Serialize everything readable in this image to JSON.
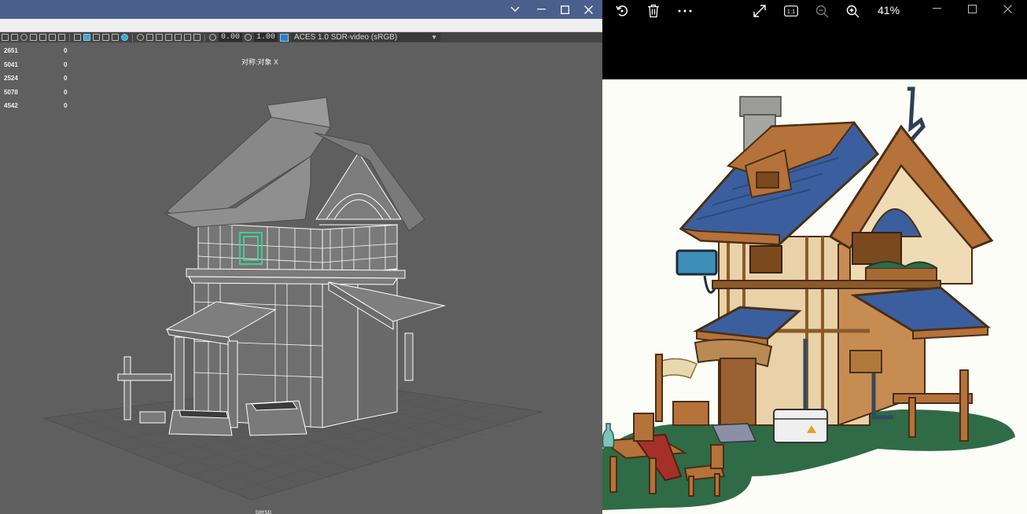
{
  "maya": {
    "title_bar": {
      "minimize_icon": "chevron-down",
      "restore_icon": "minimize",
      "maximize_icon": "square",
      "close_icon": "close"
    },
    "toolbar": {
      "field_exposure": "0.00",
      "field_gamma": "1.00",
      "color_space": "ACES 1.0 SDR-video (sRGB)"
    },
    "hud": {
      "rows": [
        {
          "value": "2651",
          "selected": "0"
        },
        {
          "value": "5041",
          "selected": "0"
        },
        {
          "value": "2524",
          "selected": "0"
        },
        {
          "value": "5078",
          "selected": "0"
        },
        {
          "value": "4542",
          "selected": "0"
        }
      ]
    },
    "viewport": {
      "selected_object": "对称:对象 X",
      "camera": "persp"
    }
  },
  "viewer": {
    "toolbar": {
      "rotate_icon": "rotate-icon",
      "delete_icon": "trash-icon",
      "more_icon": "more-icon",
      "fullscreen_icon": "expand-icon",
      "actual_size_icon": "actual-size-icon",
      "actual_size_label": "1:1",
      "zoom_out_icon": "zoom-out-icon",
      "zoom_in_icon": "zoom-in-icon",
      "zoom_level": "41%"
    },
    "window_controls": {
      "minimize": "minimize-icon",
      "maximize": "maximize-icon",
      "close": "close-icon"
    },
    "colors": {
      "roof_blue": "#3b5f9e",
      "wood": "#b5723a",
      "ground_green": "#2f6b47",
      "titlebar_blue": "#4a5f8c"
    }
  }
}
